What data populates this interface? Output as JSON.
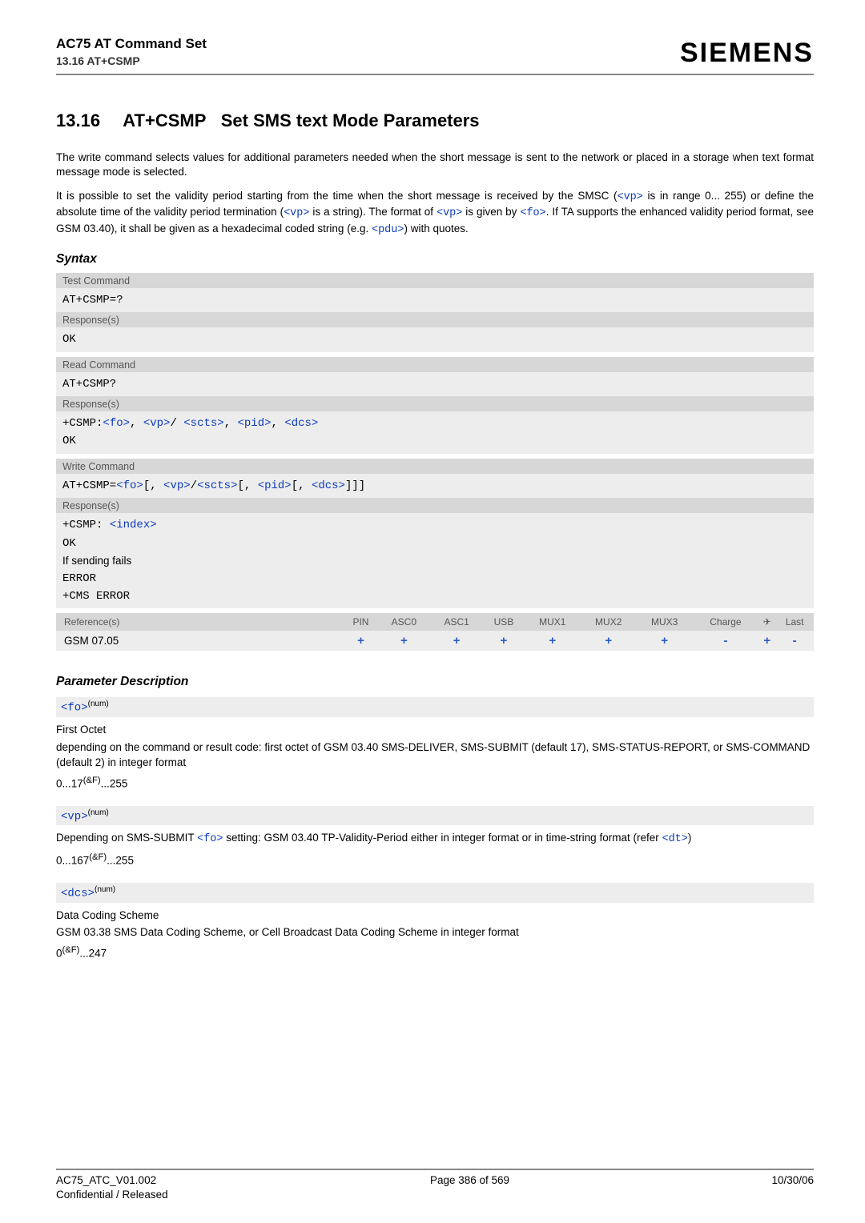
{
  "header": {
    "doc_title": "AC75 AT Command Set",
    "sub_title": "13.16 AT+CSMP",
    "brand": "SIEMENS"
  },
  "section": {
    "number": "13.16",
    "cmd": "AT+CSMP",
    "title": "Set SMS text Mode Parameters"
  },
  "intro": {
    "para1_a": "The write command selects values for additional parameters needed when the short message is sent to the network or placed in a storage when text format message mode is selected.",
    "para2_a": "It is possible to set the validity period starting from the time when the short message is received by the SMSC (",
    "vp": "<vp>",
    "para2_b": " is in range 0... 255) or define the absolute time of the validity period termination (",
    "para2_c": " is a string). The format of ",
    "para2_d": " is given by ",
    "fo": "<fo>",
    "para2_e": ". If TA supports the enhanced validity period format, see GSM 03.40), it shall be given as a hexadecimal coded string (e.g. ",
    "pdu": "<pdu>",
    "para2_f": ") with quotes."
  },
  "syntax": {
    "heading": "Syntax",
    "blocks": [
      {
        "label": "Test Command",
        "lines": [
          {
            "type": "mono",
            "text": "AT+CSMP=?"
          }
        ],
        "resp_label": "Response(s)",
        "resp_lines": [
          {
            "type": "mono",
            "text": "OK"
          }
        ]
      },
      {
        "label": "Read Command",
        "lines": [
          {
            "type": "mono",
            "text": "AT+CSMP?"
          }
        ],
        "resp_label": "Response(s)",
        "resp_lines": [
          {
            "type": "csmp_read"
          },
          {
            "type": "mono",
            "text": "OK"
          }
        ]
      },
      {
        "label": "Write Command",
        "lines": [
          {
            "type": "csmp_write"
          }
        ],
        "resp_label": "Response(s)",
        "resp_lines": [
          {
            "type": "csmp_index"
          },
          {
            "type": "mono",
            "text": "OK"
          },
          {
            "type": "plain",
            "text": "If sending fails"
          },
          {
            "type": "mono",
            "text": "ERROR"
          },
          {
            "type": "mono",
            "text": "+CMS ERROR"
          }
        ]
      }
    ],
    "tokens": {
      "csmp_prefix": "+CSMP:",
      "fo": "<fo>",
      "vp": "<vp>",
      "scts": "<scts>",
      "pid": "<pid>",
      "dcs": "<dcs>",
      "write_prefix": "AT+CSMP=",
      "index_prefix": "+CSMP: ",
      "index": "<index>"
    }
  },
  "ref_table": {
    "head_left": "Reference(s)",
    "cols": [
      "PIN",
      "ASC0",
      "ASC1",
      "USB",
      "MUX1",
      "MUX2",
      "MUX3",
      "Charge",
      "✈",
      "Last"
    ],
    "row_label": "GSM 07.05",
    "row_vals": [
      "+",
      "+",
      "+",
      "+",
      "+",
      "+",
      "+",
      "-",
      "+",
      "-"
    ]
  },
  "params": {
    "heading": "Parameter Description",
    "items": [
      {
        "tok": "<fo>",
        "sup": "(num)",
        "title": "First Octet",
        "desc": "depending on the command or result code: first octet of GSM 03.40 SMS-DELIVER, SMS-SUBMIT (default 17), SMS-STATUS-REPORT, or SMS-COMMAND (default 2) in integer format",
        "range_a": "0...17",
        "range_sup": "(&F)",
        "range_b": "...255"
      },
      {
        "tok": "<vp>",
        "sup": "(num)",
        "title": "",
        "desc_pre": "Depending on SMS-SUBMIT ",
        "desc_link": "<fo>",
        "desc_mid": " setting: GSM 03.40 TP-Validity-Period either in integer format or in time-string format (refer ",
        "desc_link2": "<dt>",
        "desc_post": ")",
        "range_a": "0...167",
        "range_sup": "(&F)",
        "range_b": "...255"
      },
      {
        "tok": "<dcs>",
        "sup": "(num)",
        "title": "Data Coding Scheme",
        "desc": "GSM 03.38 SMS Data Coding Scheme, or Cell Broadcast Data Coding Scheme in integer format",
        "range_a": "0",
        "range_sup": "(&F)",
        "range_b": "...247"
      }
    ]
  },
  "footer": {
    "left1": "AC75_ATC_V01.002",
    "left2": "Confidential / Released",
    "mid": "Page 386 of 569",
    "right": "10/30/06"
  }
}
